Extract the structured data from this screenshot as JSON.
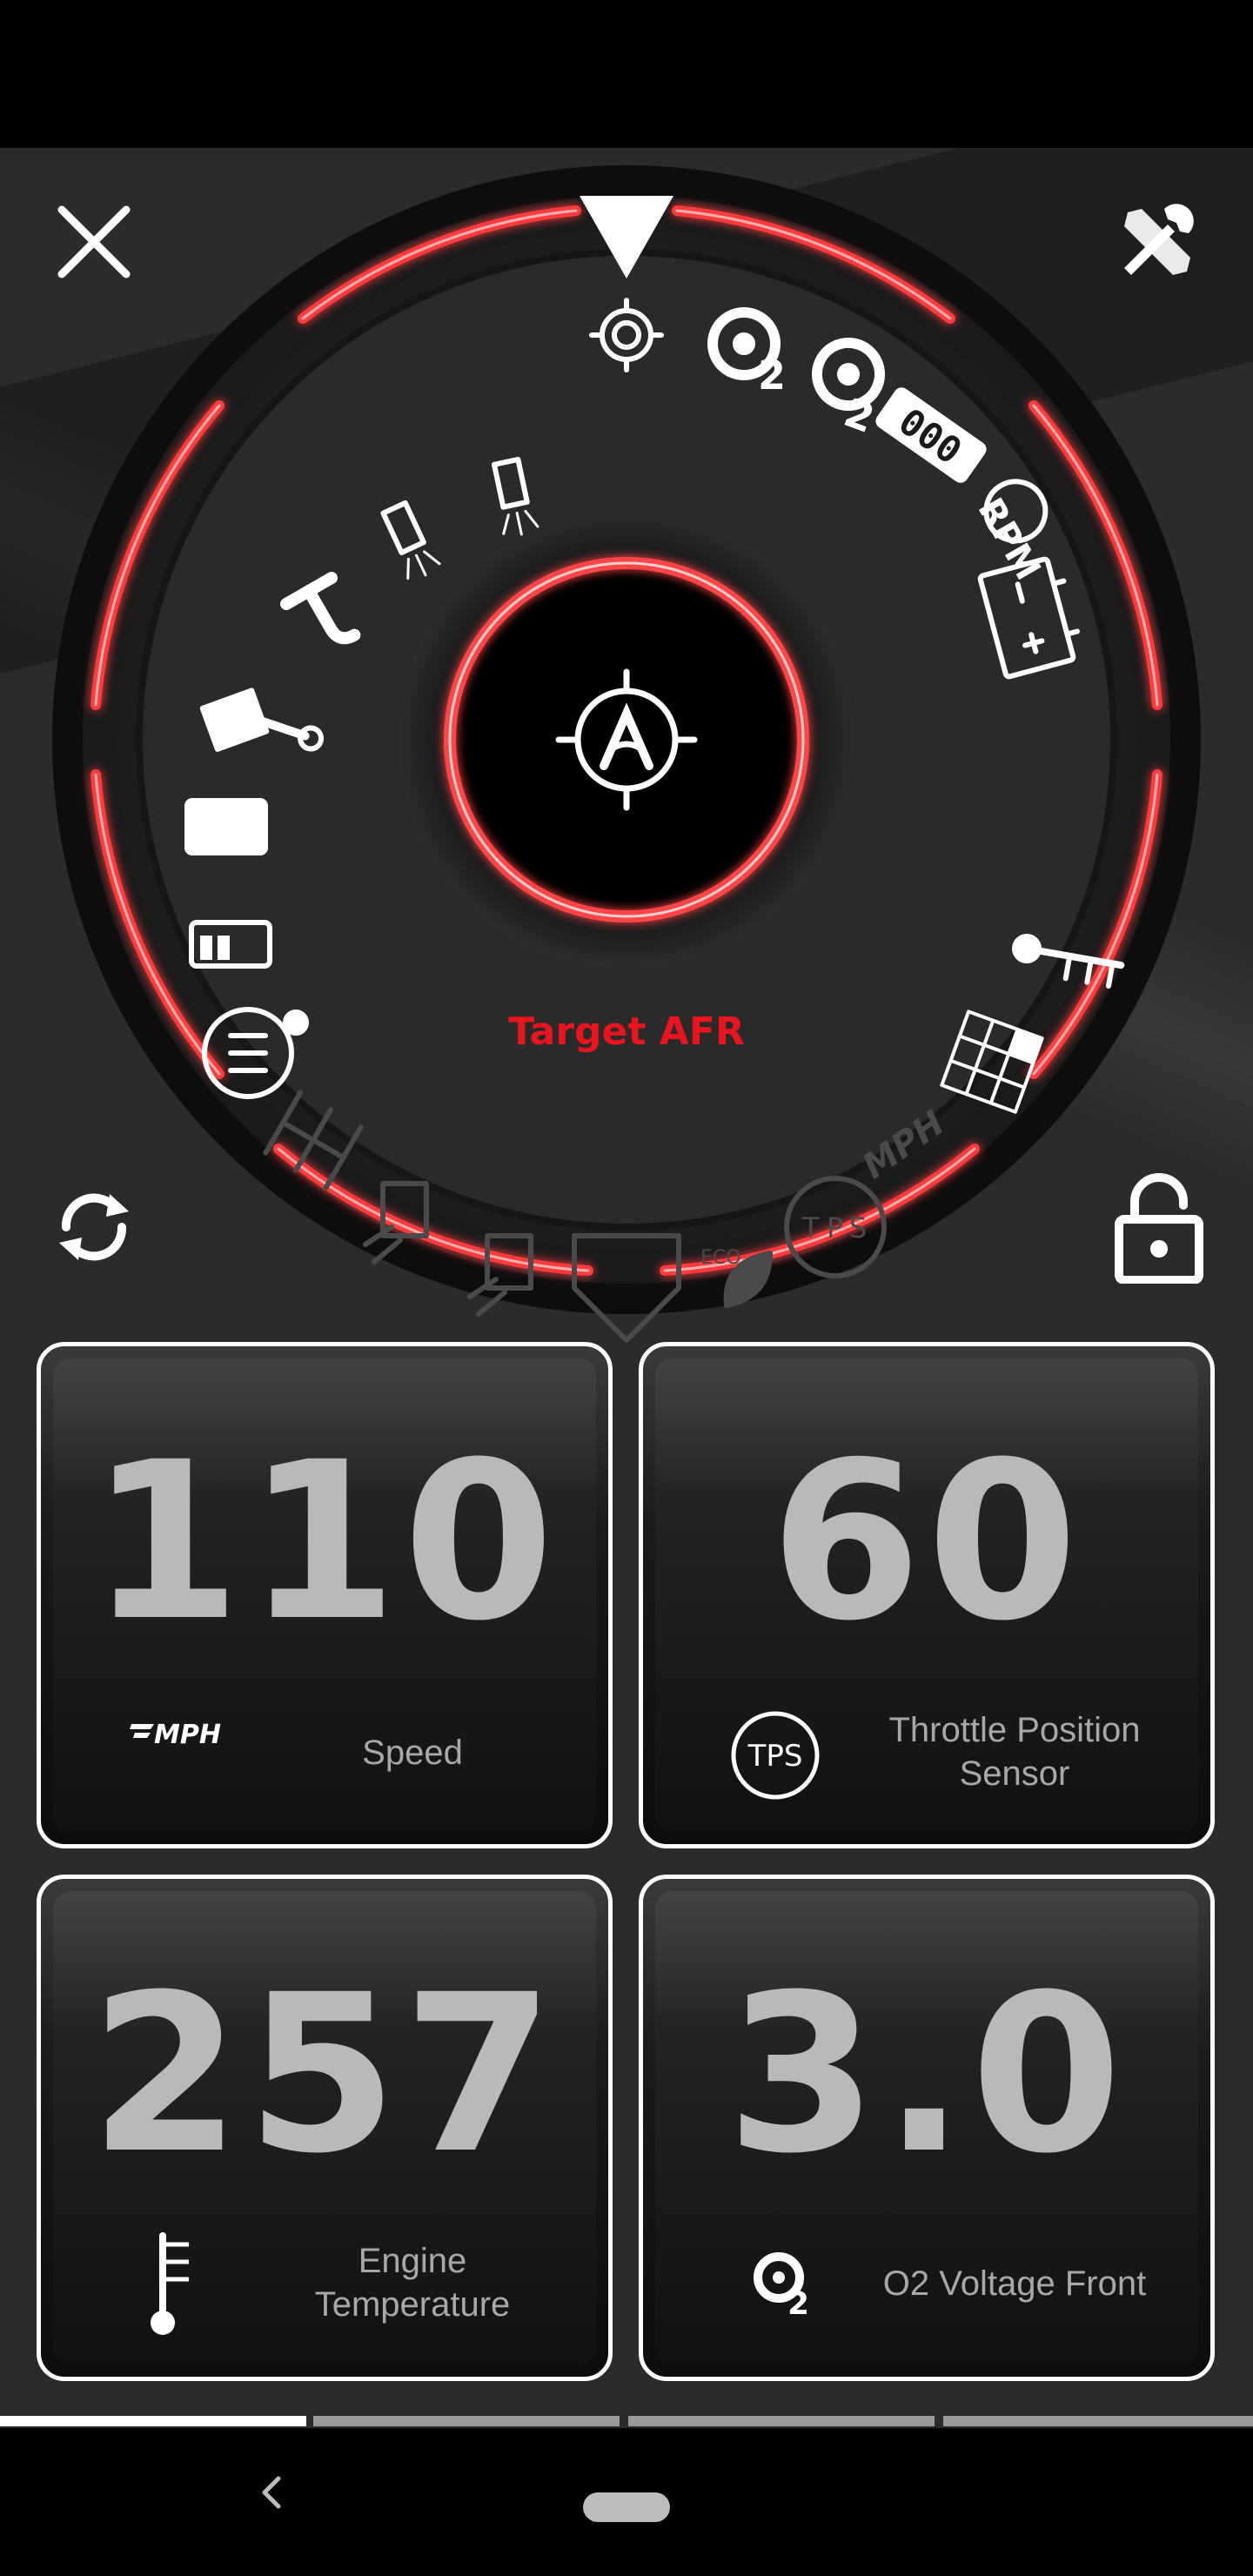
{
  "colors": {
    "accent": "#e8141e",
    "ring_glow": "#ff5a5a",
    "tile_value": "#b9b9b9",
    "tile_label": "#a8a8a8"
  },
  "header": {
    "close_icon": "close-icon",
    "settings_icon": "tools-icon"
  },
  "gauge": {
    "selected_label": "Target AFR",
    "center_icon": "target-afr-icon",
    "dial_text": {
      "tach": "000",
      "rpm": "RPM",
      "mph": "MPH",
      "eco": "ECO",
      "tps_t": "T",
      "tps_p": "P",
      "tps_s": "S",
      "o2_sub": "2"
    },
    "items": [
      "target-afr-icon",
      "o2-sensor-icon",
      "o2-sensor-2-icon",
      "tachometer-icon",
      "rpm-gauge-icon",
      "battery-icon",
      "temperature-icon",
      "fuel-map-icon",
      "speed-mph-icon",
      "throttle-position-icon",
      "eco-leaf-icon",
      "launch-icon",
      "injector-spray-icon",
      "injector-spray-2-icon",
      "shift-pattern-icon",
      "air-intake-temp-icon",
      "fuel-level-icon",
      "fuel-pressure-icon",
      "piston-rod-icon",
      "timing-icon",
      "injector-icon",
      "injector-2-icon"
    ]
  },
  "controls": {
    "refresh_icon": "refresh-icon",
    "lock_icon": "unlock-icon"
  },
  "tiles": [
    {
      "value": "110",
      "label": "Speed",
      "icon": "mph-icon",
      "icon_text": "MPH"
    },
    {
      "value": "60",
      "label": "Throttle Position Sensor",
      "icon": "tps-icon",
      "icon_text": "TPS"
    },
    {
      "value": "257",
      "label": "Engine Temperature",
      "icon": "thermometer-icon"
    },
    {
      "value": "3.0",
      "label": "O2 Voltage Front",
      "icon": "o2-icon",
      "icon_text": "2"
    }
  ],
  "pager": {
    "pages": 4,
    "active": 0
  },
  "nav": {
    "back_icon": "back-icon",
    "home_icon": "home-pill-icon"
  }
}
